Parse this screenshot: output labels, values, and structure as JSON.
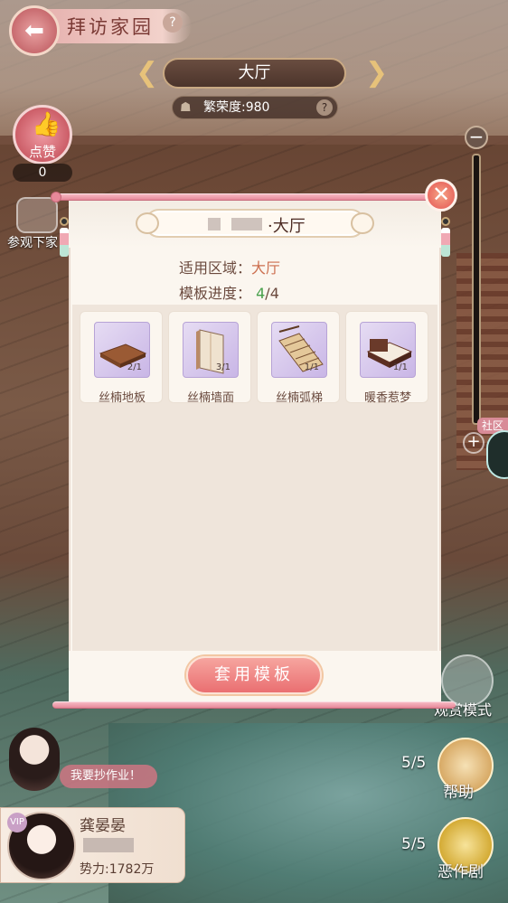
{
  "header": {
    "title": "拜访家园",
    "help_glyph": "?",
    "back_glyph": "⬅"
  },
  "room_selector": {
    "current": "大厅",
    "prev_glyph": "❮",
    "next_glyph": "❯"
  },
  "prosperity": {
    "text": "繁荣度:980",
    "help_glyph": "?"
  },
  "left_panel": {
    "like_label": "点赞",
    "like_count": "0",
    "visit_label": "参观下家"
  },
  "right_panel": {
    "zoom_glyph": "−",
    "community_label": "社区",
    "plus_glyph": "+",
    "mode_label": "观赏模式",
    "help_label": "帮助",
    "help_count": "5/5",
    "prank_label": "恶作剧",
    "prank_count": "5/5"
  },
  "chat": {
    "speech": "我要抄作业！"
  },
  "player": {
    "name": "龚晏晏",
    "power": "势力:1782万",
    "badge": "VIP"
  },
  "modal": {
    "title_suffix": "·大厅",
    "close_glyph": "✕",
    "area_label": "适用区域：",
    "area_value": "大厅",
    "progress_label": "模板进度：",
    "progress_done": "4",
    "progress_total": "/4",
    "items": [
      {
        "name": "丝楠地板",
        "qty": "2/1"
      },
      {
        "name": "丝楠墙面",
        "qty": "3/1"
      },
      {
        "name": "丝楠弧梯",
        "qty": "1/1"
      },
      {
        "name": "暖香惹梦",
        "qty": "1/1"
      }
    ],
    "apply_label": "套用模板"
  }
}
